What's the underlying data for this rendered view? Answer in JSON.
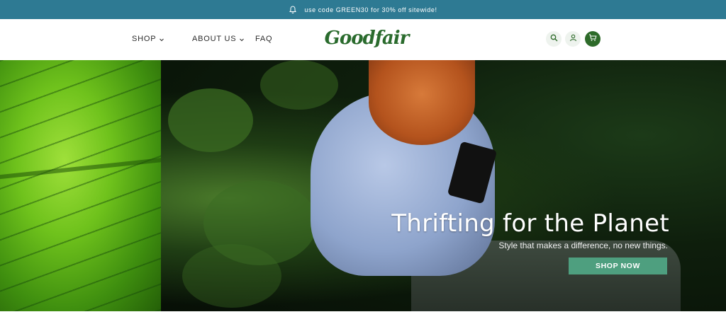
{
  "announcement": {
    "text": "use code GREEN30 for 30% off sitewide!",
    "icon": "bell-icon"
  },
  "nav": {
    "shop": "SHOP",
    "about": "ABOUT US",
    "faq": "FAQ"
  },
  "brand": {
    "logo_text": "Goodfair",
    "color": "#2a6b2d"
  },
  "header_icons": [
    "search-icon",
    "account-icon",
    "cart-icon"
  ],
  "hero": {
    "title": "Thrifting for the Planet",
    "subtitle": "Style that makes a difference, no new things.",
    "cta_label": "SHOP NOW",
    "cta_color": "#4e9f7f"
  },
  "colors": {
    "announcement_bg": "#2e7a93",
    "cart_bg": "#2e6b2a"
  }
}
